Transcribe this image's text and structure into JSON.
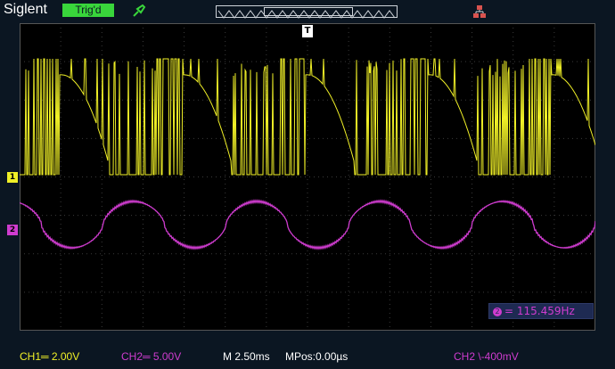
{
  "header": {
    "brand": "Siglent",
    "trigger_status": "Trig'd",
    "probe_icon": "probe-icon",
    "lan_icon": "lan-icon"
  },
  "markers": {
    "trigger_position": "T",
    "ch1": "1",
    "ch2": "2"
  },
  "measurement": {
    "channel": "2",
    "value": "= 115.459Hz"
  },
  "status": {
    "ch1": "CH1═ 2.00V",
    "ch2": "CH2═ 5.00V",
    "timebase": "M 2.50ms",
    "mpos": "MPos:0.00µs",
    "trigger": "CH2  \\-400mV"
  },
  "colors": {
    "ch1": "#f0f027",
    "ch2": "#cf3ccf",
    "grid": "#3a3a3a",
    "background": "#0b1622"
  }
}
